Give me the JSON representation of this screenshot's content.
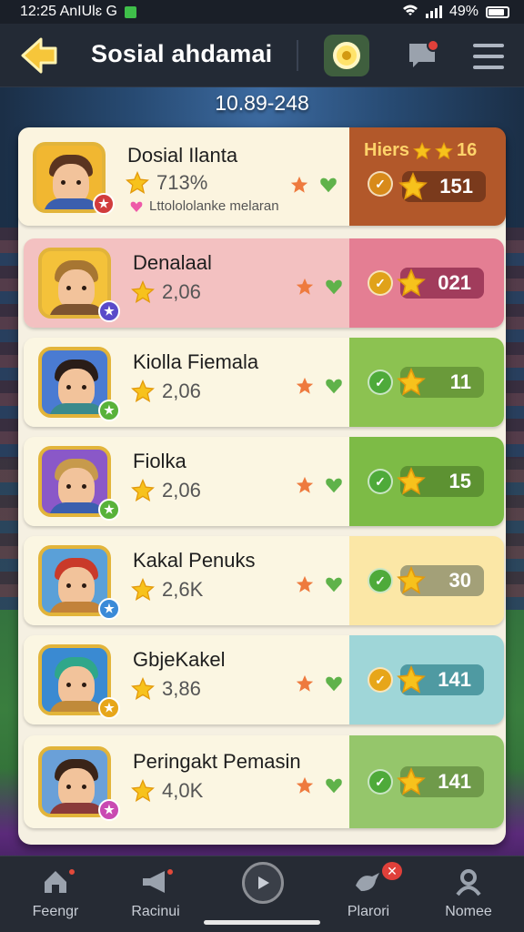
{
  "status_bar": {
    "time_text": "12:25 AnIUlɛ G",
    "battery": "49%"
  },
  "header": {
    "title": "Sosial ahdamai"
  },
  "score_line": "10.89-248",
  "rows": [
    {
      "name": "Dosial Ilanta",
      "stat": "713%",
      "sub": "Lttolololanke melaran",
      "side_label": "Hiers",
      "side_label_num": "16",
      "side_value": "151",
      "main_bg": "#fbf4df",
      "side_bg": "#b2582a",
      "pill_bg": "#7a3a1c",
      "round_color": "#d88a1a",
      "avatar_bg": "#f1b731",
      "hair": "#5a3420",
      "shirt": "#3b5fae",
      "badge_color": "#d13c3c"
    },
    {
      "name": "Denalaal",
      "stat": "2,06",
      "sub": "",
      "side_value": "021",
      "main_bg": "#f3c1c1",
      "side_bg": "#e47e93",
      "pill_bg": "#a13c5c",
      "round_color": "#e0a21a",
      "avatar_bg": "#f4c23a",
      "hair": "#a77632",
      "shirt": "#7d5430",
      "badge_color": "#5a4ac9"
    },
    {
      "name": "Kiolla Fiemala",
      "stat": "2,06",
      "sub": "",
      "side_value": "11",
      "main_bg": "#fbf6e2",
      "side_bg": "#8cc251",
      "pill_bg": "#6a9a3a",
      "round_color": "#4eaa3a",
      "avatar_bg": "#4a7bd2",
      "hair": "#2a1d18",
      "shirt": "#3a8a8c",
      "badge_color": "#58b23a"
    },
    {
      "name": "Fiolka",
      "stat": "2,06",
      "sub": "",
      "side_value": "15",
      "main_bg": "#fbf6e2",
      "side_bg": "#7dbb46",
      "pill_bg": "#5d9232",
      "round_color": "#4eaa3a",
      "avatar_bg": "#8a58c8",
      "hair": "#c79a4c",
      "shirt": "#3b5fae",
      "badge_color": "#58b23a"
    },
    {
      "name": "Kakal Penuks",
      "stat": "2,6K",
      "sub": "",
      "side_value": "30",
      "main_bg": "#fbf6e2",
      "side_bg": "#fbe7a6",
      "pill_bg": "#a3a078",
      "round_color": "#4eaa3a",
      "avatar_bg": "#5aa0d8",
      "hair": "#c93a2a",
      "shirt": "#c2823a",
      "badge_color": "#3a8ad8"
    },
    {
      "name": "GbjeKakel",
      "stat": "3,86",
      "sub": "",
      "side_value": "141",
      "main_bg": "#fbf6e2",
      "side_bg": "#9fd6d8",
      "pill_bg": "#4f9aa2",
      "round_color": "#e7a61a",
      "avatar_bg": "#3a8ad2",
      "hair": "#2fa78a",
      "shirt": "#c08a3a",
      "badge_color": "#e7a61a"
    },
    {
      "name": "Peringakt Pemasin",
      "stat": "4,0K",
      "sub": "",
      "side_value": "141",
      "main_bg": "#fbf6e2",
      "side_bg": "#95c66b",
      "pill_bg": "#6f9a4a",
      "round_color": "#4eaa3a",
      "avatar_bg": "#6aa0d8",
      "hair": "#3a2418",
      "shirt": "#8a3a3a",
      "badge_color": "#c94ab2"
    }
  ],
  "bottom_nav": [
    {
      "label": "Feengr",
      "icon": "home-icon"
    },
    {
      "label": "Racinui",
      "icon": "megaphone-icon"
    },
    {
      "label": "",
      "icon": "play-icon"
    },
    {
      "label": "Plarori",
      "icon": "bird-icon"
    },
    {
      "label": "Nomee",
      "icon": "profile-icon"
    }
  ],
  "colors": {
    "header_bg": "#232a35",
    "panel_bg": "#f5f0e2",
    "star": "#f7c21c"
  }
}
